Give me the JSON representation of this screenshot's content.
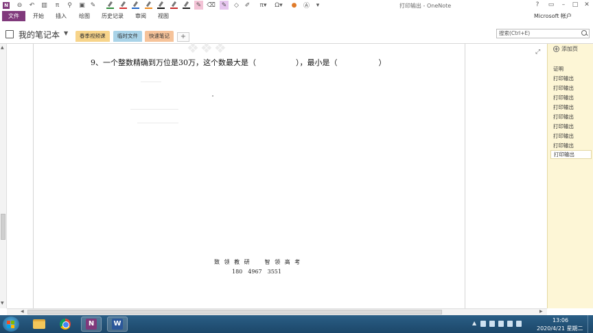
{
  "window": {
    "title": "打印输出 - OneNote",
    "help": "?",
    "account": "Microsoft 帐户"
  },
  "menu": {
    "file": "文件",
    "items": [
      "开始",
      "插入",
      "绘图",
      "历史记录",
      "审阅",
      "视图"
    ]
  },
  "quick_access": {
    "pi_symbol": "π",
    "omega_symbol": "Ω"
  },
  "notebook": {
    "name": "我的笔记本",
    "sections": [
      {
        "label": "春季视频课",
        "color": "#f7d48a"
      },
      {
        "label": "临时文件",
        "color": "#a9d3e8"
      },
      {
        "label": "快速笔记",
        "color": "#f6c39a"
      }
    ],
    "add_section": "+"
  },
  "search": {
    "placeholder": "搜索(Ctrl+E)"
  },
  "page_content": {
    "question_part1": "9、一个整数精确到万位是30万，这个数最大是（",
    "question_part2": "），最小是（",
    "question_part3": "）",
    "footer_line1": "致 领 教 研　　智 领 高 考",
    "footer_line2": "180　4967　3551"
  },
  "pages_panel": {
    "add_page": "添加页",
    "pages": [
      "证明",
      "打印输出",
      "打印输出",
      "打印输出",
      "打印输出",
      "打印输出",
      "打印输出",
      "打印输出",
      "打印输出",
      "打印输出"
    ],
    "active_index": 9
  },
  "taskbar": {
    "apps": [
      "file-explorer",
      "chrome",
      "onenote",
      "word"
    ],
    "onenote_letter": "N",
    "word_letter": "W",
    "time": "13:06",
    "date": "2020/4/21 星期二"
  }
}
